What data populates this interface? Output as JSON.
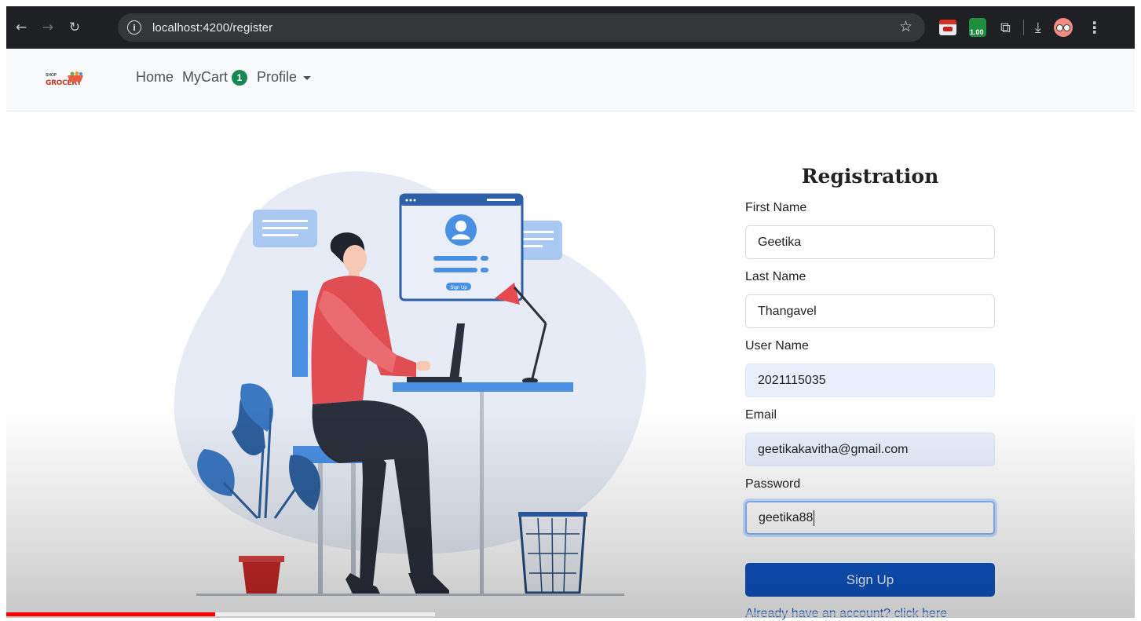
{
  "browser": {
    "url": "localhost:4200/register",
    "speed_badge": "1.00"
  },
  "navbar": {
    "logo_text_top": "SHOP",
    "logo_text_main": "GROCERY",
    "links": {
      "home": "Home",
      "cart": "MyCart",
      "cart_count": "1",
      "profile": "Profile"
    }
  },
  "form": {
    "title": "Registration",
    "first_name_label": "First Name",
    "first_name_value": "Geetika",
    "last_name_label": "Last Name",
    "last_name_value": "Thangavel",
    "username_label": "User Name",
    "username_value": "2021115035",
    "email_label": "Email",
    "email_value": "geetikakavitha@gmail.com",
    "password_label": "Password",
    "password_value": "geetika88",
    "submit_label": "Sign Up",
    "login_link": "Already have an account? click here"
  },
  "illustration": {
    "mini_signup_label": "Sign Up"
  },
  "video": {
    "progress_fraction": 0.185
  },
  "colors": {
    "primary_button": "#0d55c4",
    "badge": "#198754",
    "link": "#1f63c9",
    "progress": "#ff0000"
  }
}
